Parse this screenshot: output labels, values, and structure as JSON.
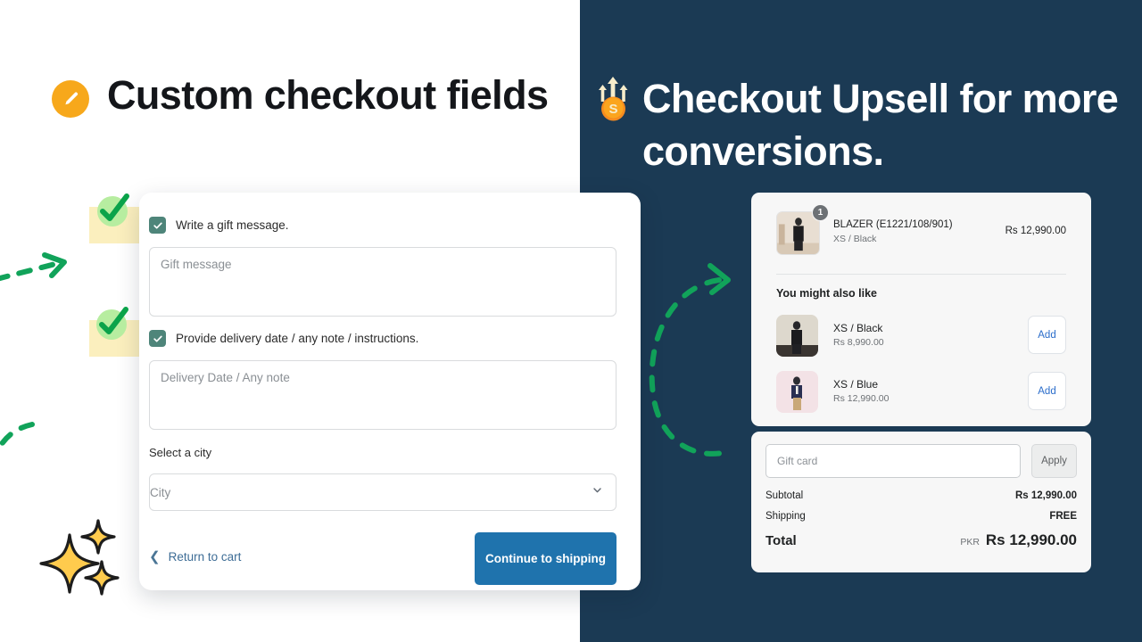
{
  "colors": {
    "navy": "#1b3a54",
    "orange": "#f7a81b",
    "green": "#11a35a",
    "teal_checkbox": "#4e857a",
    "highlight_yellow": "#fbefbe",
    "cta_blue": "#1f73ad",
    "link_blue": "#2c6ecb",
    "sparkle_yellow": "#ffcb4d"
  },
  "left": {
    "heading": "Custom checkout fields",
    "heading_icon": "pencil-icon",
    "checkbox_rows": [
      {
        "label": "Write a gift message.",
        "checked": true
      },
      {
        "label": "Provide delivery date / any note / instructions.",
        "checked": true
      }
    ],
    "fields": {
      "gift_message_placeholder": "Gift message",
      "delivery_placeholder": "Delivery Date / Any note",
      "city_label": "Select a city",
      "city_placeholder": "City"
    },
    "footer": {
      "return_link": "Return to cart",
      "cta": "Continue to shipping"
    }
  },
  "right": {
    "heading": "Checkout Upsell for more conversions.",
    "heading_icon": "coin-arrows-up-icon",
    "cart": {
      "line_item": {
        "title": "BLAZER (E1221/108/901)",
        "variant": "XS / Black",
        "price": "Rs 12,990.00",
        "qty": "1"
      },
      "upsell_title": "You might also like",
      "upsell_items": [
        {
          "title": "XS / Black",
          "price": "Rs 8,990.00",
          "add_label": "Add"
        },
        {
          "title": "XS / Blue",
          "price": "Rs 12,990.00",
          "add_label": "Add"
        }
      ],
      "giftcard_placeholder": "Gift card",
      "apply_label": "Apply",
      "summary": [
        {
          "label": "Subtotal",
          "value": "Rs 12,990.00"
        },
        {
          "label": "Shipping",
          "value": "FREE"
        }
      ],
      "total": {
        "label": "Total",
        "currency": "PKR",
        "value": "Rs 12,990.00"
      }
    }
  }
}
